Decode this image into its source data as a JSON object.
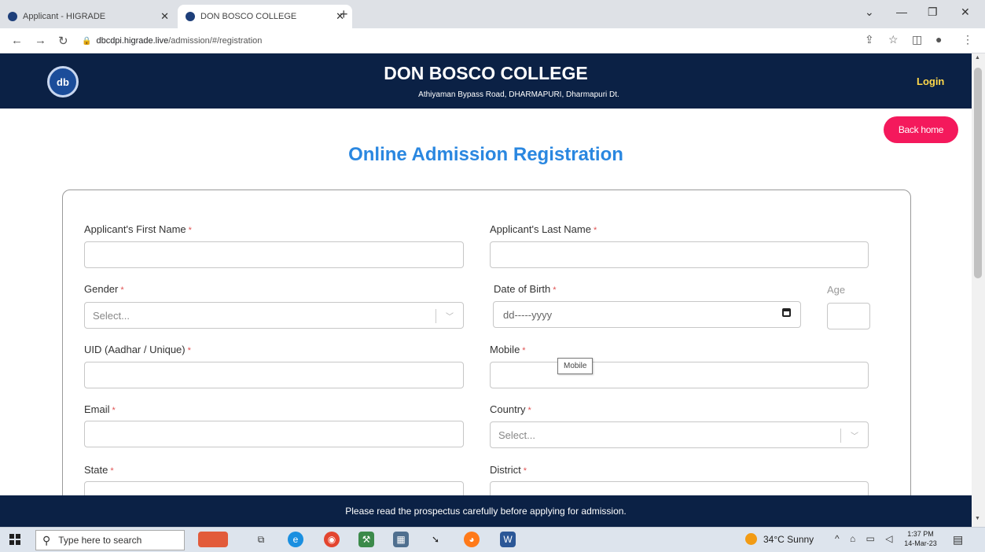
{
  "browser": {
    "tabs": [
      {
        "title": "Applicant - HIGRADE"
      },
      {
        "title": "DON BOSCO COLLEGE"
      }
    ],
    "url_host": "dbcdpi.higrade.live",
    "url_path": "/admission/#/registration"
  },
  "page": {
    "college_name": "DON BOSCO COLLEGE",
    "college_address": "Athiyaman Bypass Road, DHARMAPURI, Dharmapuri Dt.",
    "login_label": "Login",
    "back_home_label": "Back home",
    "form_title": "Online Admission Registration",
    "footer_text": "Please read the prospectus carefully before applying for admission."
  },
  "form": {
    "first_name_label": "Applicant's First Name",
    "last_name_label": "Applicant's Last Name",
    "gender_label": "Gender",
    "gender_placeholder": "Select...",
    "dob_label": "Date of Birth",
    "dob_placeholder": "dd-----yyyy",
    "age_label": "Age",
    "uid_label": "UID (Aadhar / Unique)",
    "mobile_label": "Mobile",
    "mobile_tooltip": "Mobile",
    "email_label": "Email",
    "country_label": "Country",
    "country_placeholder": "Select...",
    "state_label": "State",
    "district_label": "District",
    "required_mark": "*"
  },
  "taskbar": {
    "search_placeholder": "Type here to search",
    "weather": "34°C  Sunny",
    "time": "1:37 PM",
    "date": "14-Mar-23"
  },
  "colors": {
    "navbar": "#0b2145",
    "title": "#2a87e0",
    "back_home": "#f4195c",
    "login": "#ffd84a"
  }
}
